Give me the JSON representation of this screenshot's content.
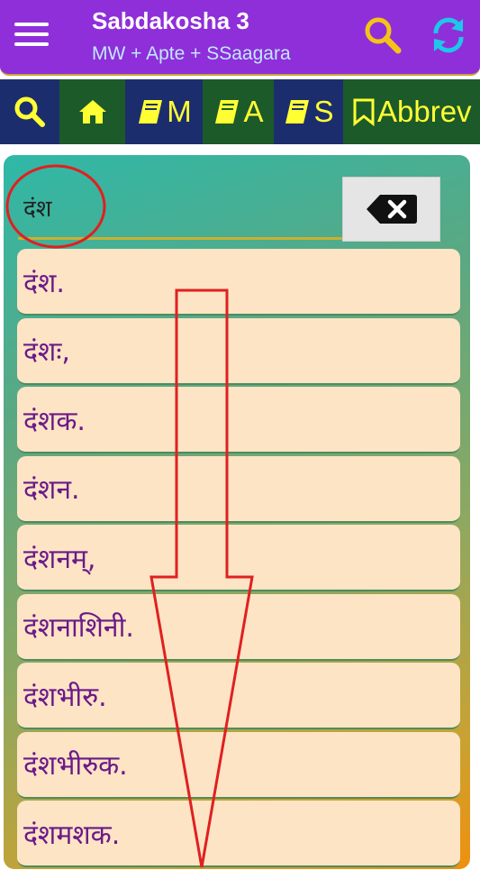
{
  "appbar": {
    "title": "Sabdakosha 3",
    "subtitle": "MW + Apte + SSaagara",
    "icons": [
      "menu-icon",
      "search-icon",
      "refresh-icon"
    ]
  },
  "tabs": [
    {
      "label": "",
      "icon": "search-icon",
      "bg": "#1c2d6e"
    },
    {
      "label": "",
      "icon": "home-icon",
      "bg": "#1c5a2a"
    },
    {
      "label": "M",
      "icon": "book-icon",
      "bg": "#1c2d6e"
    },
    {
      "label": "A",
      "icon": "book-icon",
      "bg": "#1c5a2a"
    },
    {
      "label": "S",
      "icon": "book-icon",
      "bg": "#1c2d6e"
    },
    {
      "label": "Abbrev",
      "icon": "bookmark-icon",
      "bg": "#1c5a2a"
    }
  ],
  "search": {
    "value": "दंश"
  },
  "results": [
    "दंश.",
    "दंशः,",
    "दंशक.",
    "दंशन.",
    "दंशनम्,",
    "दंशनाशिनी.",
    "दंशभीरु.",
    "दंशभीरुक.",
    "दंशमशक."
  ],
  "colors": {
    "appbar": "#8f2fd9",
    "tab_text": "#ffff33",
    "item_bg": "#fde4c5",
    "item_text": "#6b1a88",
    "annotation": "#e02020"
  }
}
